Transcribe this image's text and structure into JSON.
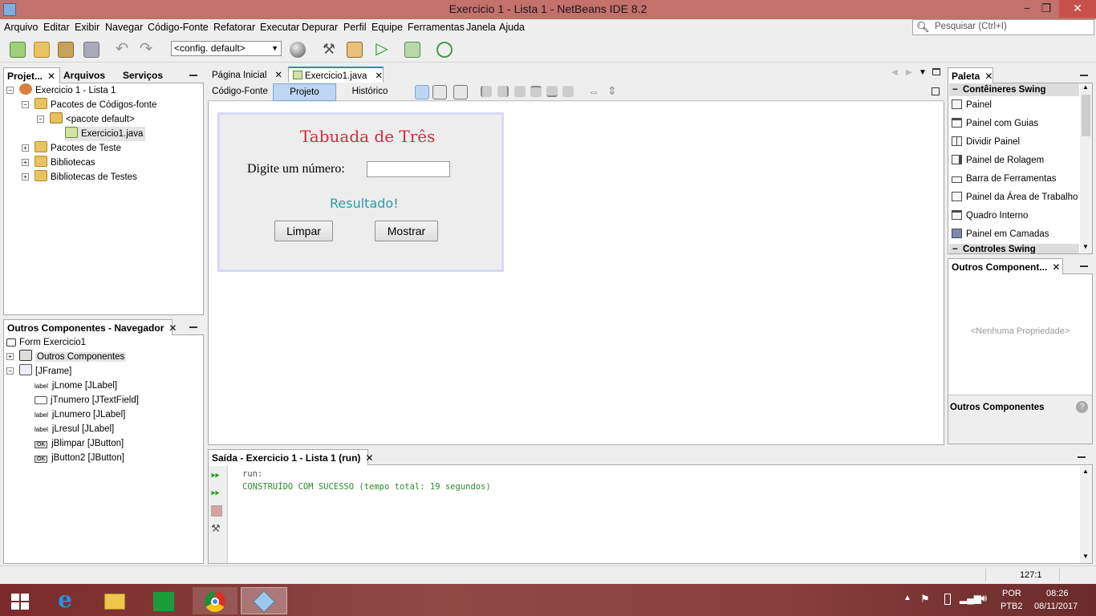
{
  "window": {
    "title": "Exercicio 1 - Lista 1 - NetBeans IDE 8.2",
    "minimize": "−",
    "restore": "❐",
    "close": "✕"
  },
  "menu": [
    "Arquivo",
    "Editar",
    "Exibir",
    "Navegar",
    "Código-Fonte",
    "Refatorar",
    "Executar",
    "Depurar",
    "Perfil",
    "Equipe",
    "Ferramentas",
    "Janela",
    "Ajuda"
  ],
  "search": {
    "placeholder": "Pesquisar (Ctrl+I)"
  },
  "toolbar": {
    "config_value": "<config. default>"
  },
  "projects_panel": {
    "tabs": [
      "Projet...",
      "Arquivos",
      "Serviços"
    ],
    "tree": [
      "Exercicio 1 - Lista 1",
      "Pacotes de Códigos-fonte",
      "<pacote default>",
      "Exercicio1.java",
      "Pacotes de Teste",
      "Bibliotecas",
      "Bibliotecas de Testes"
    ]
  },
  "navigator_panel": {
    "title": "Outros Componentes - Navegador",
    "root": "Form Exercicio1",
    "items": [
      "Outros Componentes",
      "[JFrame]",
      "jLnome [JLabel]",
      "jTnumero [JTextField]",
      "jLnumero [JLabel]",
      "jLresul [JLabel]",
      "jBlimpar [JButton]",
      "jButton2 [JButton]"
    ],
    "label_icon_text": "label",
    "button_icon_text": "OK"
  },
  "editor": {
    "tabs": [
      "Página Inicial",
      "Exercicio1.java"
    ],
    "views": [
      "Código-Fonte",
      "Projeto",
      "Histórico"
    ],
    "active_view": "Projeto"
  },
  "form": {
    "title": "Tabuada de Três",
    "prompt_label": "Digite um número:",
    "input_value": "",
    "result_label": "Resultado!",
    "clear_button": "Limpar",
    "show_button": "Mostrar"
  },
  "palette": {
    "title": "Paleta",
    "category1": "Contêineres Swing",
    "items": [
      "Painel",
      "Painel com Guias",
      "Dividir Painel",
      "Painel de Rolagem",
      "Barra de Ferramentas",
      "Painel da Área de Trabalho",
      "Quadro Interno",
      "Painel em Camadas"
    ],
    "category2": "Controles Swing"
  },
  "properties_panel": {
    "title": "Outros Component...",
    "empty_text": "<Nenhuma Propriedade>",
    "footer": "Outros Componentes"
  },
  "output": {
    "title": "Saída - Exercicio 1 - Lista 1 (run)",
    "lines": [
      "run:",
      "CONSTRUÍDO COM SUCESSO (tempo total: 19 segundos)"
    ],
    "success_color": "#2f8a2f"
  },
  "statusbar": {
    "position": "127:1"
  },
  "taskbar": {
    "lang1": "POR",
    "lang2": "PTB2",
    "time": "08:26",
    "date": "08/11/2017"
  },
  "colors": {
    "titlebar": "#c4706b",
    "form_title": "#d8283c",
    "result": "#2a9aa5",
    "active_view": "#bcd6f3"
  }
}
